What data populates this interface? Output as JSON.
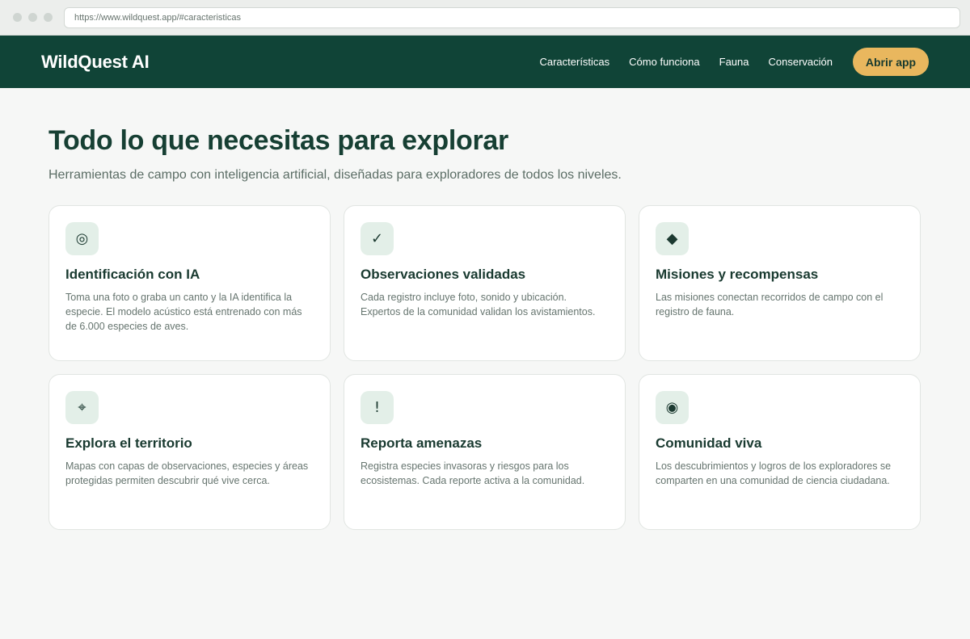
{
  "browser": {
    "url": "https://www.wildquest.app/#caracteristicas"
  },
  "nav": {
    "brand": "WildQuest AI",
    "links": [
      "Características",
      "Cómo funciona",
      "Fauna",
      "Conservación"
    ],
    "cta": "Abrir app"
  },
  "hero": {
    "title": "Todo lo que necesitas para explorar",
    "subtitle": "Herramientas de campo con inteligencia artificial, diseñadas para exploradores de todos los niveles."
  },
  "features": [
    {
      "icon": "target-icon",
      "glyph": "◎",
      "title": "Identificación con IA",
      "desc": "Toma una foto o graba un canto y la IA identifica la especie. El modelo acústico está entrenado con más de 6.000 especies de aves."
    },
    {
      "icon": "check-icon",
      "glyph": "✓",
      "title": "Observaciones validadas",
      "desc": "Cada registro incluye foto, sonido y ubicación. Expertos de la comunidad validan los avistamientos."
    },
    {
      "icon": "diamond-icon",
      "glyph": "◆",
      "title": "Misiones y recompensas",
      "desc": "Las misiones conectan recorridos de campo con el registro de fauna."
    },
    {
      "icon": "location-icon",
      "glyph": "⌖",
      "title": "Explora el territorio",
      "desc": "Mapas con capas de observaciones, especies y áreas protegidas permiten descubrir qué vive cerca."
    },
    {
      "icon": "alert-icon",
      "glyph": "!",
      "title": "Reporta amenazas",
      "desc": "Registra especies invasoras y riesgos para los ecosistemas. Cada reporte activa a la comunidad."
    },
    {
      "icon": "community-icon",
      "glyph": "◉",
      "title": "Comunidad viva",
      "desc": "Los descubrimientos y logros de los exploradores se comparten en una comunidad de ciencia ciudadana."
    }
  ]
}
